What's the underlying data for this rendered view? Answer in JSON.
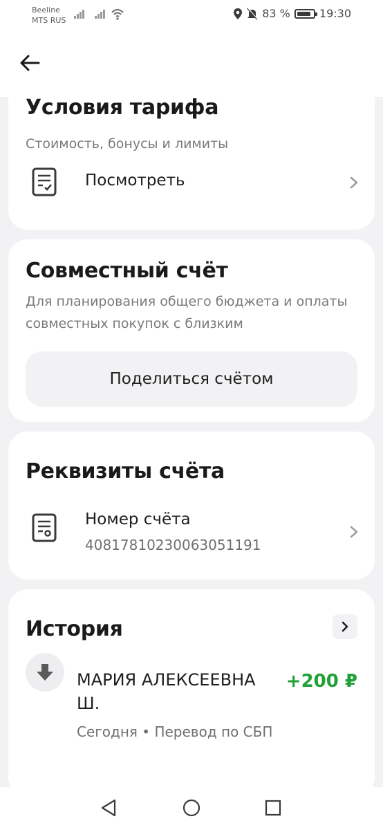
{
  "status_bar": {
    "carrier_1": "Beeline",
    "carrier_2": "MTS RUS",
    "battery": "83 %",
    "time": "19:30"
  },
  "tariff": {
    "title": "Условия тарифа",
    "subtitle": "Стоимость, бонусы и лимиты",
    "view_label": "Посмотреть"
  },
  "joint_account": {
    "title": "Совместный счёт",
    "description": "Для планирования общего бюджета и оплаты совместных покупок с близким",
    "share_button": "Поделиться счётом"
  },
  "details": {
    "title": "Реквизиты счёта",
    "account_number_label": "Номер счёта",
    "account_number": "40817810230063051191"
  },
  "history": {
    "title": "История",
    "transactions": [
      {
        "name": "МАРИЯ АЛЕКСЕЕВНА Ш.",
        "meta": "Сегодня • Перевод по СБП",
        "amount": "+200 ₽"
      }
    ]
  },
  "colors": {
    "background": "#f2f2f5",
    "card": "#ffffff",
    "income": "#21a038"
  },
  "icons": [
    "back-arrow-icon",
    "document-check-icon",
    "document-badge-icon",
    "chevron-right-icon",
    "arrow-down-icon",
    "nav-back-icon",
    "nav-home-icon",
    "nav-recents-icon"
  ]
}
